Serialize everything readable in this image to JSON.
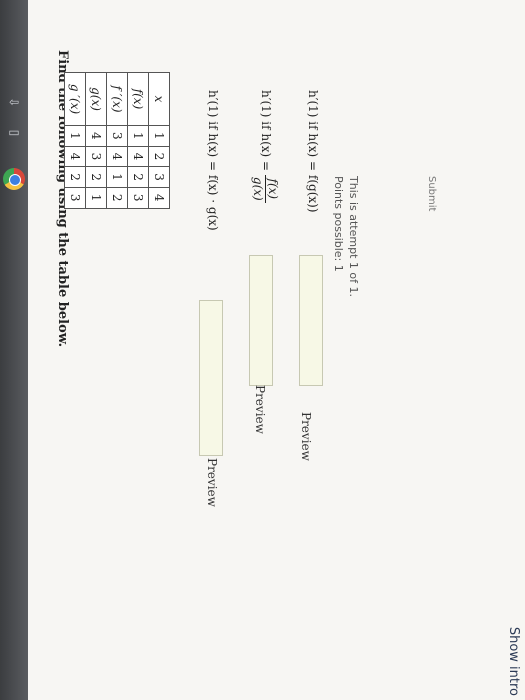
{
  "header": {
    "show_intro": "Show intro"
  },
  "question": {
    "title": "Find the following using the table below.",
    "table": {
      "rows": [
        {
          "label": "x",
          "values": [
            "1",
            "2",
            "3",
            "4"
          ]
        },
        {
          "label": "f(x)",
          "values": [
            "1",
            "4",
            "2",
            "3"
          ]
        },
        {
          "label": "f ′(x)",
          "values": [
            "3",
            "4",
            "1",
            "2"
          ]
        },
        {
          "label": "g(x)",
          "values": [
            "4",
            "3",
            "2",
            "1"
          ]
        },
        {
          "label": "g ′(x)",
          "values": [
            "1",
            "4",
            "2",
            "3"
          ]
        }
      ]
    },
    "parts": [
      {
        "label": "h′(1) if h(x) = f(x) · g(x)",
        "preview": "Preview"
      },
      {
        "label_prefix": "h′(1) if h(x) =",
        "frac_num": "f(x)",
        "frac_den": "g(x)",
        "preview": "Preview"
      },
      {
        "label": "h′(1) if h(x) = f(g(x))",
        "preview": "Preview"
      }
    ]
  },
  "meta": {
    "points": "Points possible: 1",
    "attempt": "This is attempt 1 of 1."
  },
  "submit_label": "Submit"
}
